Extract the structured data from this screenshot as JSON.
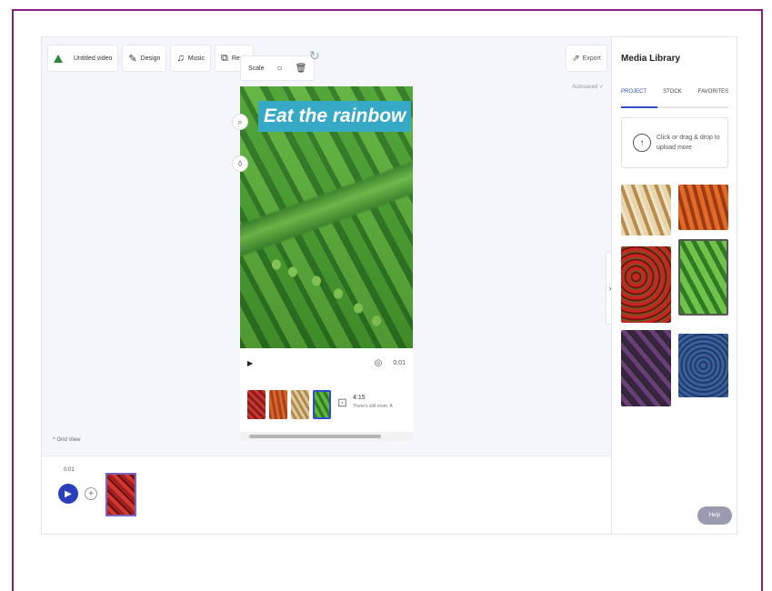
{
  "toolbar": {
    "project_name": "Untitled video",
    "design_label": "Design",
    "music_label": "Music",
    "resize_label": "Resiz"
  },
  "context_toolbar": {
    "scale_label": "Scale"
  },
  "export_label": "Export",
  "autosaved_label": "Autosaved ✓",
  "canvas": {
    "caption": "Eat the rainbow"
  },
  "player": {
    "time": "0:01"
  },
  "filmstrip": {
    "time": "4:15",
    "text": "There's still room. A"
  },
  "grid_view_label": "Grid View",
  "timeline": {
    "time": "0:01"
  },
  "media_library": {
    "title": "Media Library",
    "tabs": [
      "PROJECT",
      "STOCK",
      "FAVORITES"
    ],
    "upload_text": "Click or drag & drop to upload more",
    "thumbnails": [
      "onions",
      "carrots",
      "strawberries",
      "peas",
      "purple cabbage",
      "blueberries"
    ]
  },
  "help_label": "Help",
  "colors": {
    "accent": "#2a4fc9",
    "caption_bg": "#35a9c5",
    "frame_border": "#8a1f86"
  }
}
